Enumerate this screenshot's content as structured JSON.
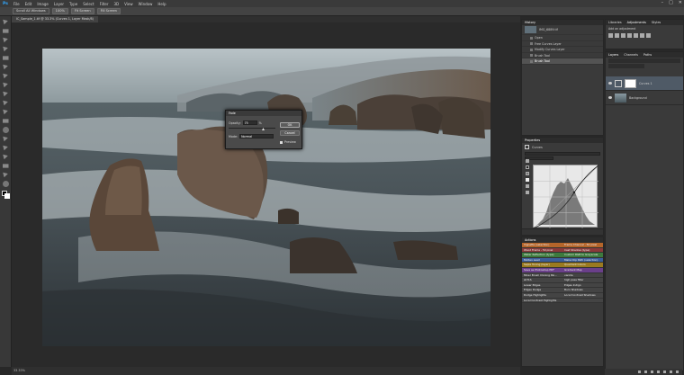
{
  "app": {
    "logo": "Ps"
  },
  "menu": [
    "File",
    "Edit",
    "Image",
    "Layer",
    "Type",
    "Select",
    "Filter",
    "3D",
    "View",
    "Window",
    "Help"
  ],
  "options": {
    "buttons": [
      "Scroll All Windows",
      "100%",
      "Fit Screen",
      "Fill Screen"
    ]
  },
  "document_tab": "IC_Sample_1.tif @ 33.3% (Curves 1, Layer Mask/8)",
  "status": "33.33%",
  "panels": {
    "history": {
      "tabs": [
        "History"
      ],
      "snapshot": "IMG_6889.tif",
      "items": [
        "Open",
        "Free Curves Layer",
        "Modify Curves Layer",
        "Brush Tool",
        "Brush Tool"
      ]
    },
    "properties": {
      "tabs": [
        "Properties"
      ],
      "title": "Curves"
    },
    "actions": {
      "tabs": [
        "Actions"
      ],
      "items": [
        {
          "label": "Vignette (selection)",
          "color": "#b4652a"
        },
        {
          "label": "Frame Channel - 50 pixel",
          "color": "#b4652a"
        },
        {
          "label": "Wood Frame - 50 pixel",
          "color": "#8b3a3a"
        },
        {
          "label": "Cast Shadow (type)",
          "color": "#8b3a3a"
        },
        {
          "label": "Water Reflection (type)",
          "color": "#3d7a3d"
        },
        {
          "label": "Custom RGB to Grayscale",
          "color": "#3d7a3d"
        },
        {
          "label": "Molten Lead",
          "color": "#3b5e9a"
        },
        {
          "label": "Make Clip Path (selection)",
          "color": "#3b5e9a"
        },
        {
          "label": "Sepia Toning (layer)",
          "color": "#9a7a20"
        },
        {
          "label": "Quadrant Colors",
          "color": "#9a7a20"
        },
        {
          "label": "Save as Photoshop PDF",
          "color": "#6a3f8a"
        },
        {
          "label": "Gradient Map",
          "color": "#6a3f8a"
        },
        {
          "label": "Mixer Brush Cloning Pai...",
          "color": "#444444"
        },
        {
          "label": "vanilla",
          "color": "#444444"
        },
        {
          "label": "sbTLS",
          "color": "#444444"
        },
        {
          "label": "high pass filter",
          "color": "#444444"
        },
        {
          "label": "Lower Edges",
          "color": "#444444"
        },
        {
          "label": "Edges Indigo",
          "color": "#444444"
        },
        {
          "label": "Edges Dodge",
          "color": "#444444"
        },
        {
          "label": "Burn Shadows",
          "color": "#444444"
        },
        {
          "label": "Dodge Highlights",
          "color": "#444444"
        },
        {
          "label": "Local Contrast Shadows",
          "color": "#444444"
        },
        {
          "label": "Local Contrast Highlights",
          "color": "#444444"
        },
        {
          "label": "",
          "color": "#444444"
        }
      ]
    },
    "adjustments": {
      "tabs": [
        "Libraries",
        "Adjustments",
        "Styles"
      ],
      "subtitle": "Add an adjustment"
    },
    "layers": {
      "tabs": [
        "Layers",
        "Channels",
        "Paths"
      ],
      "rows": [
        {
          "name": "Curves 1"
        },
        {
          "name": "Background"
        }
      ]
    }
  },
  "dialog": {
    "title": "Fade",
    "opacity_label": "Opacity:",
    "opacity_value": "75",
    "opacity_unit": "%",
    "mode_label": "Mode:",
    "mode_value": "Normal",
    "ok": "OK",
    "cancel": "Cancel",
    "preview": "Preview"
  }
}
